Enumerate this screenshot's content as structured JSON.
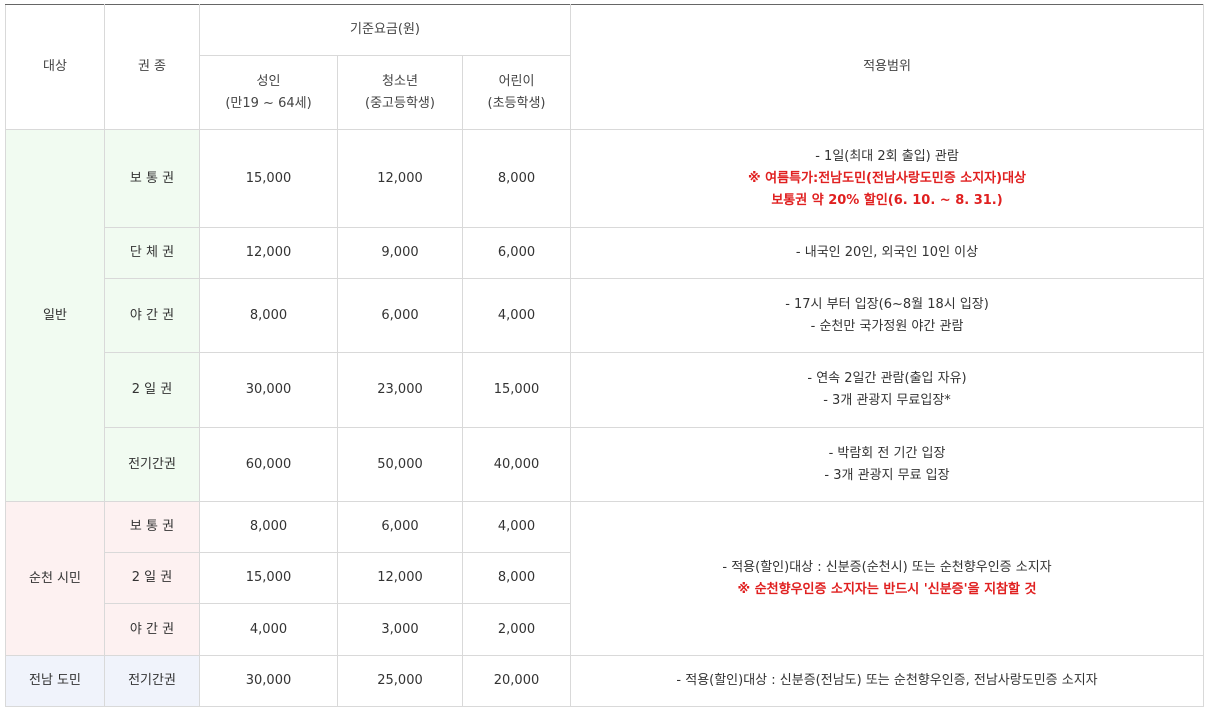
{
  "header": {
    "target": "대상",
    "ticket_type": "권 종",
    "base_fee": "기준요금(원)",
    "adult_line1": "성인",
    "adult_line2": "(만19 ~ 64세)",
    "youth_line1": "청소년",
    "youth_line2": "(중고등학생)",
    "child_line1": "어린이",
    "child_line2": "(초등학생)",
    "scope": "적용범위"
  },
  "groups": {
    "general": "일반",
    "citizen": "순천 시민",
    "provincial": "전남 도민"
  },
  "rows": [
    {
      "ticket": "보 통 권",
      "adult": "15,000",
      "youth": "12,000",
      "child": "8,000",
      "scope": [
        "- 1일(최대 2회 출입) 관람"
      ],
      "scope_red": [
        "※ 여름특가:전남도민(전남사랑도민증 소지자)대상",
        "보통권 약 20% 할인(6. 10. ~ 8. 31.)"
      ]
    },
    {
      "ticket": "단 체 권",
      "adult": "12,000",
      "youth": "9,000",
      "child": "6,000",
      "scope": [
        "- 내국인 20인, 외국인 10인 이상"
      ]
    },
    {
      "ticket": "야 간 권",
      "adult": "8,000",
      "youth": "6,000",
      "child": "4,000",
      "scope": [
        "- 17시 부터 입장(6~8월 18시 입장)",
        "- 순천만 국가정원 야간 관람"
      ]
    },
    {
      "ticket": "2 일 권",
      "adult": "30,000",
      "youth": "23,000",
      "child": "15,000",
      "scope": [
        "- 연속 2일간 관람(출입 자유)",
        "- 3개 관광지 무료입장*"
      ]
    },
    {
      "ticket": "전기간권",
      "adult": "60,000",
      "youth": "50,000",
      "child": "40,000",
      "scope": [
        "- 박람회 전 기간 입장",
        "- 3개 관광지 무료 입장"
      ]
    },
    {
      "ticket": "보 통 권",
      "adult": "8,000",
      "youth": "6,000",
      "child": "4,000"
    },
    {
      "ticket": "2 일 권",
      "adult": "15,000",
      "youth": "12,000",
      "child": "8,000"
    },
    {
      "ticket": "야 간 권",
      "adult": "4,000",
      "youth": "3,000",
      "child": "2,000"
    },
    {
      "ticket": "전기간권",
      "adult": "30,000",
      "youth": "25,000",
      "child": "20,000",
      "scope": [
        "- 적용(할인)대상 : 신분증(전남도) 또는 순천향우인증, 전남사랑도민증 소지자"
      ]
    }
  ],
  "citizen_scope": {
    "line": "- 적용(할인)대상 : 신분증(순천시) 또는 순천향우인증 소지자",
    "red": "※ 순천향우인증 소지자는 반드시 '신분증'을 지참할 것"
  }
}
